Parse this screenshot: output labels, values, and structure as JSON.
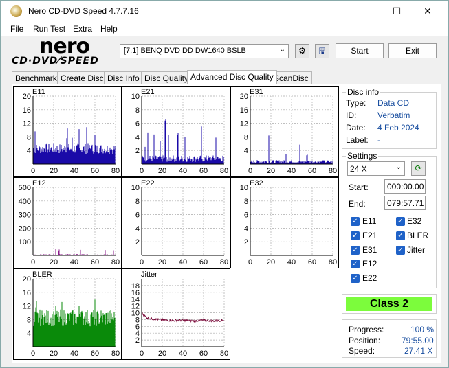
{
  "window": {
    "title": "Nero CD-DVD Speed 4.7.7.16",
    "minimize": "—",
    "maximize": "☐",
    "close": "✕"
  },
  "menu": [
    "File",
    "Run Test",
    "Extra",
    "Help"
  ],
  "logo": {
    "word": "nero",
    "sub": "CD·DVD⁄SPEED"
  },
  "toolbar": {
    "drive": "[7:1]   BENQ DVD DD DW1640 BSLB",
    "start": "Start",
    "exit": "Exit"
  },
  "tabs": [
    "Benchmark",
    "Create Disc",
    "Disc Info",
    "Disc Quality",
    "Advanced Disc Quality",
    "ScanDisc"
  ],
  "active_tab": "Advanced Disc Quality",
  "disc_info": {
    "title": "Disc info",
    "type_label": "Type:",
    "type": "Data CD",
    "id_label": "ID:",
    "id": "Verbatim",
    "date_label": "Date:",
    "date": "4 Feb 2024",
    "label_label": "Label:",
    "label": "-"
  },
  "settings": {
    "title": "Settings",
    "speed": "24 X",
    "start_label": "Start:",
    "start": "000:00.00",
    "end_label": "End:",
    "end": "079:57.71"
  },
  "checks": {
    "e11": "E11",
    "e21": "E21",
    "e31": "E31",
    "e12": "E12",
    "e22": "E22",
    "e32": "E32",
    "bler": "BLER",
    "jitter": "Jitter"
  },
  "class": "Class 2",
  "progress": {
    "progress_label": "Progress:",
    "progress": "100 %",
    "position_label": "Position:",
    "position": "79:55.00",
    "speed_label": "Speed:",
    "speed": "27.41 X"
  },
  "colors": {
    "blue": "#1a0aa8",
    "purple": "#8a1a8a",
    "green": "#0a8a0a",
    "jitter": "#7a0a3a",
    "class_bg": "#7cfc3c"
  },
  "chart_data": [
    {
      "name": "E11",
      "type": "bar",
      "color": "#1a0aa8",
      "ylim": [
        0,
        20
      ],
      "yticks": [
        4,
        8,
        12,
        16,
        20
      ],
      "xticks": [
        0,
        20,
        40,
        60,
        80
      ],
      "base": 3,
      "noise": 3,
      "spikes": [
        [
          2,
          12
        ],
        [
          12,
          14
        ],
        [
          22,
          14
        ],
        [
          33,
          12
        ],
        [
          38,
          10
        ],
        [
          45,
          12
        ],
        [
          52,
          14
        ],
        [
          56,
          12
        ],
        [
          60,
          10
        ],
        [
          64,
          12
        ],
        [
          70,
          10
        ],
        [
          75,
          10
        ]
      ]
    },
    {
      "name": "E21",
      "type": "bar",
      "color": "#1a0aa8",
      "ylim": [
        0,
        10
      ],
      "yticks": [
        2,
        4,
        6,
        8,
        10
      ],
      "xticks": [
        0,
        20,
        40,
        60,
        80
      ],
      "base": 0.3,
      "noise": 1,
      "spikes": [
        [
          3,
          4
        ],
        [
          6,
          6
        ],
        [
          12,
          5
        ],
        [
          18,
          4
        ],
        [
          23,
          7
        ],
        [
          26,
          5
        ],
        [
          30,
          9
        ],
        [
          35,
          6
        ],
        [
          42,
          5
        ],
        [
          48,
          7
        ],
        [
          53,
          4
        ],
        [
          58,
          6
        ],
        [
          63,
          5
        ],
        [
          68,
          4
        ],
        [
          72,
          6
        ],
        [
          78,
          5
        ]
      ]
    },
    {
      "name": "E31",
      "type": "bar",
      "color": "#1a0aa8",
      "ylim": [
        0,
        20
      ],
      "yticks": [
        4,
        8,
        12,
        16,
        20
      ],
      "xticks": [
        0,
        20,
        40,
        60,
        80
      ],
      "base": 0.2,
      "noise": 1,
      "spikes": [
        [
          5,
          6
        ],
        [
          12,
          10
        ],
        [
          18,
          14
        ],
        [
          20,
          12
        ],
        [
          28,
          6
        ],
        [
          35,
          5
        ],
        [
          42,
          8
        ],
        [
          48,
          6
        ],
        [
          55,
          4
        ],
        [
          62,
          6
        ],
        [
          70,
          5
        ]
      ]
    },
    {
      "name": "E12",
      "type": "bar",
      "color": "#8a1a8a",
      "ylim": [
        0,
        500
      ],
      "yticks": [
        100,
        200,
        300,
        400,
        500
      ],
      "xticks": [
        0,
        20,
        40,
        60,
        80
      ],
      "base": 0,
      "noise": 10,
      "spikes": [
        [
          10,
          40
        ],
        [
          22,
          60
        ],
        [
          25,
          50
        ],
        [
          30,
          45
        ],
        [
          35,
          110
        ],
        [
          40,
          70
        ],
        [
          46,
          50
        ],
        [
          60,
          40
        ],
        [
          70,
          50
        ],
        [
          78,
          40
        ]
      ]
    },
    {
      "name": "E22",
      "type": "bar",
      "color": "#8a1a8a",
      "ylim": [
        0,
        10
      ],
      "yticks": [
        2,
        4,
        6,
        8,
        10
      ],
      "xticks": [
        0,
        20,
        40,
        60,
        80
      ],
      "base": 0,
      "noise": 0,
      "spikes": []
    },
    {
      "name": "E32",
      "type": "bar",
      "color": "#8a1a8a",
      "ylim": [
        0,
        10
      ],
      "yticks": [
        2,
        4,
        6,
        8,
        10
      ],
      "xticks": [
        0,
        20,
        40,
        60,
        80
      ],
      "base": 0,
      "noise": 0,
      "spikes": []
    },
    {
      "name": "BLER",
      "type": "bar",
      "color": "#0a8a0a",
      "ylim": [
        0,
        20
      ],
      "yticks": [
        4,
        8,
        12,
        16,
        20
      ],
      "xticks": [
        0,
        20,
        40,
        60,
        80
      ],
      "base": 6,
      "noise": 5,
      "spikes": [
        [
          3,
          14
        ],
        [
          10,
          16
        ],
        [
          18,
          14
        ],
        [
          22,
          16
        ],
        [
          28,
          14
        ],
        [
          32,
          18
        ],
        [
          36,
          14
        ],
        [
          45,
          16
        ],
        [
          50,
          14
        ],
        [
          56,
          18
        ],
        [
          60,
          14
        ],
        [
          66,
          12
        ],
        [
          72,
          14
        ]
      ]
    },
    {
      "name": "Jitter",
      "type": "line",
      "color": "#7a0a3a",
      "ylim": [
        0,
        20
      ],
      "yticks": [
        2,
        4,
        6,
        8,
        10,
        12,
        14,
        16,
        18
      ],
      "xticks": [
        0,
        20,
        40,
        60,
        80
      ],
      "points": [
        [
          0,
          10
        ],
        [
          2,
          9.3
        ],
        [
          5,
          8.6
        ],
        [
          10,
          8.2
        ],
        [
          20,
          7.9
        ],
        [
          30,
          7.7
        ],
        [
          40,
          7.8
        ],
        [
          50,
          7.6
        ],
        [
          60,
          7.8
        ],
        [
          70,
          7.6
        ],
        [
          80,
          7.8
        ]
      ]
    }
  ]
}
